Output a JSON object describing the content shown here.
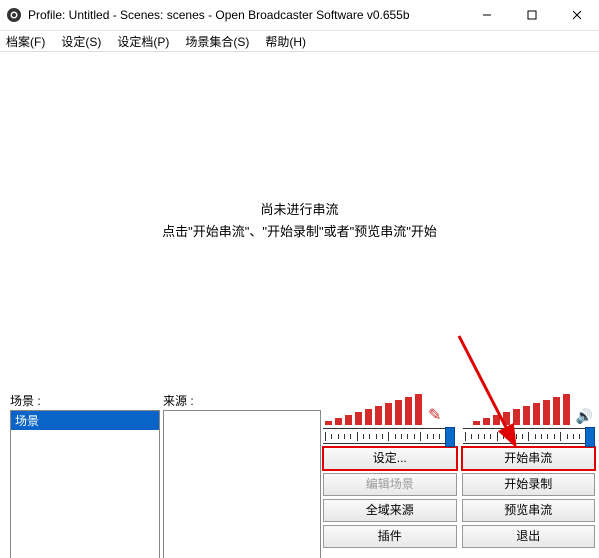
{
  "titlebar": {
    "text": "Profile: Untitled - Scenes: scenes - Open Broadcaster Software v0.655b"
  },
  "menubar": {
    "file": "档案(F)",
    "settings": "设定(S)",
    "profiles": "设定档(P)",
    "scene_collections": "场景集合(S)",
    "help": "帮助(H)"
  },
  "preview": {
    "line1": "尚未进行串流",
    "line2": "点击\"开始串流\"、\"开始录制\"或者\"预览串流\"开始"
  },
  "panels": {
    "scenes_label": "场景 :",
    "sources_label": "来源 :",
    "scene_items": [
      "场景"
    ]
  },
  "buttons": {
    "settings": "设定...",
    "edit_scene": "编辑场景",
    "global_sources": "全域来源",
    "plugins": "插件",
    "start_streaming": "开始串流",
    "start_recording": "开始录制",
    "preview_stream": "预览串流",
    "exit": "退出"
  },
  "meters": {
    "mic_icon": "✎",
    "desktop_icon": "🔊"
  }
}
